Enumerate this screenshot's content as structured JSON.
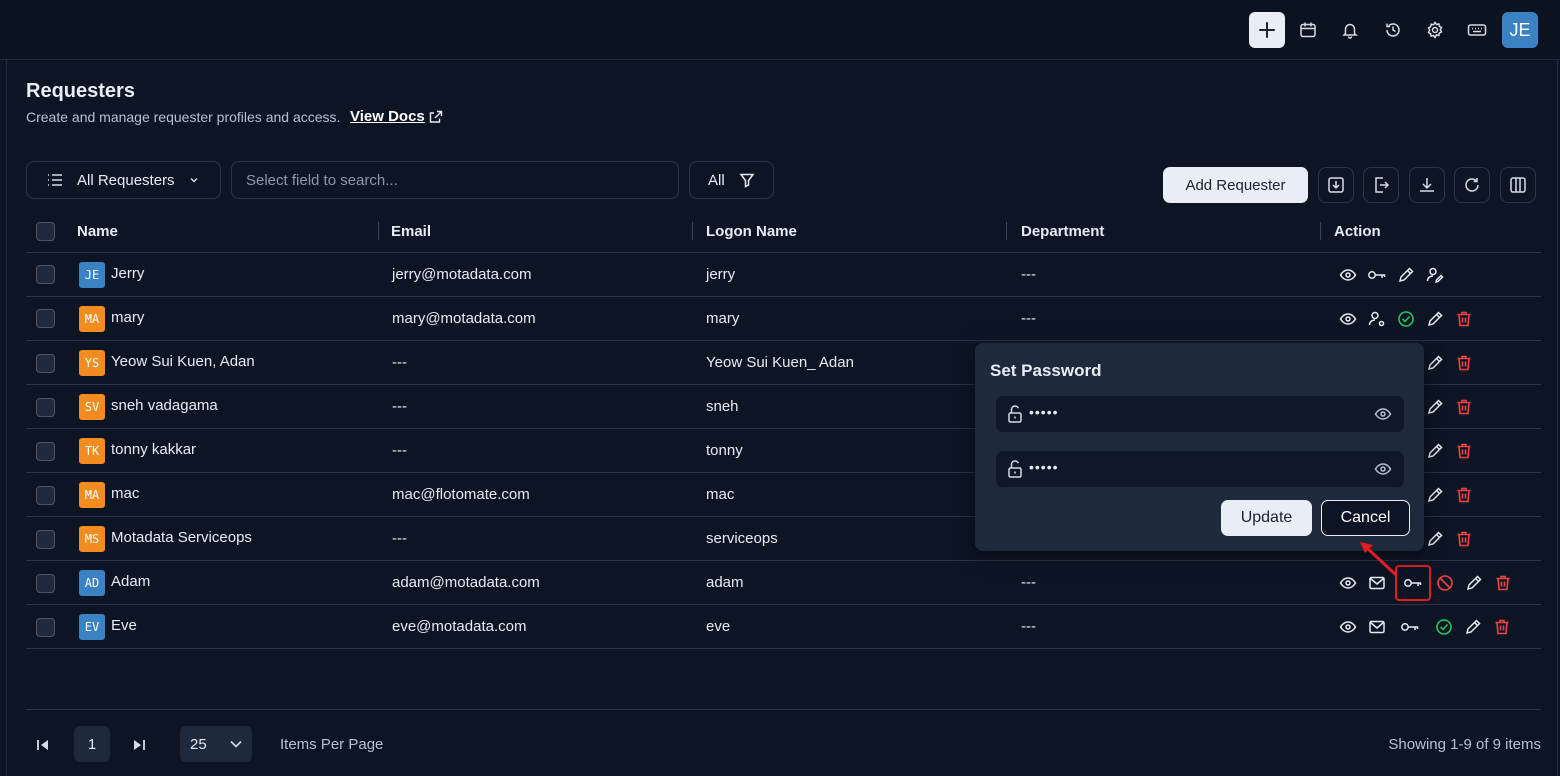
{
  "topbar": {
    "user_initials": "JE",
    "icons": [
      "plus-icon",
      "calendar-icon",
      "bell-icon",
      "history-icon",
      "gear-icon",
      "keyboard-icon"
    ]
  },
  "page": {
    "title": "Requesters",
    "subtitle": "Create and manage requester profiles and access.",
    "docs_link": "View Docs"
  },
  "toolbar": {
    "requester_filter": "All Requesters",
    "search_placeholder": "Select field to search...",
    "filter_label": "All",
    "add_button": "Add Requester",
    "icon_buttons": [
      "import-icon",
      "export-icon",
      "download-icon",
      "refresh-icon",
      "columns-icon"
    ]
  },
  "table": {
    "columns": [
      "Name",
      "Email",
      "Logon Name",
      "Department",
      "Action"
    ],
    "rows": [
      {
        "initials": "JE",
        "avatar_color": "blue",
        "name": "Jerry",
        "email": "jerry@motadata.com",
        "logon": "jerry",
        "department": "---",
        "actions": [
          "view",
          "key",
          "edit",
          "user-edit"
        ]
      },
      {
        "initials": "MA",
        "avatar_color": "orange",
        "name": "mary",
        "email": "mary@motadata.com",
        "logon": "mary",
        "department": "---",
        "actions": [
          "view",
          "user-gear",
          "check",
          "edit",
          "delete"
        ]
      },
      {
        "initials": "YS",
        "avatar_color": "orange",
        "name": "Yeow Sui Kuen, Adan",
        "email": "---",
        "logon": "Yeow Sui Kuen_ Adan",
        "department": "",
        "actions": [
          "edit",
          "delete"
        ]
      },
      {
        "initials": "SV",
        "avatar_color": "orange",
        "name": "sneh vadagama",
        "email": "---",
        "logon": "sneh",
        "department": "",
        "actions": [
          "edit",
          "delete"
        ]
      },
      {
        "initials": "TK",
        "avatar_color": "orange",
        "name": "tonny kakkar",
        "email": "---",
        "logon": "tonny",
        "department": "",
        "actions": [
          "edit",
          "delete"
        ]
      },
      {
        "initials": "MA",
        "avatar_color": "orange",
        "name": "mac",
        "email": "mac@flotomate.com",
        "logon": "mac",
        "department": "",
        "actions": [
          "edit",
          "delete"
        ]
      },
      {
        "initials": "MS",
        "avatar_color": "orange",
        "name": "Motadata Serviceops",
        "email": "---",
        "logon": "serviceops",
        "department": "",
        "actions": [
          "edit",
          "delete"
        ]
      },
      {
        "initials": "AD",
        "avatar_color": "blue",
        "name": "Adam",
        "email": "adam@motadata.com",
        "logon": "adam",
        "department": "---",
        "actions": [
          "view",
          "mail",
          "key",
          "block",
          "edit",
          "delete"
        ]
      },
      {
        "initials": "EV",
        "avatar_color": "blue",
        "name": "Eve",
        "email": "eve@motadata.com",
        "logon": "eve",
        "department": "---",
        "actions": [
          "view",
          "mail",
          "key",
          "check",
          "edit",
          "delete"
        ]
      }
    ]
  },
  "popup": {
    "title": "Set Password",
    "password_mask": "•••••",
    "confirm_mask": "•••••",
    "update_button": "Update",
    "cancel_button": "Cancel"
  },
  "pagination": {
    "current_page": "1",
    "page_size": "25",
    "items_per_page_label": "Items Per Page",
    "showing_text": "Showing 1-9 of 9 items"
  },
  "colors": {
    "background": "#0d1525",
    "panel": "#1e293b",
    "highlight": "#e11d22",
    "delete": "#ef4444",
    "success": "#22c55e",
    "avatar_blue": "#3b82c4",
    "avatar_orange": "#f28c20"
  }
}
